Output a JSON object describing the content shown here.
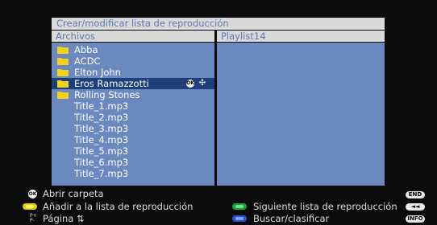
{
  "panel": {
    "title": "Crear/modificar lista de reproducción"
  },
  "left_column": {
    "header": "Archivos",
    "items": [
      {
        "type": "folder",
        "label": "Abba"
      },
      {
        "type": "folder",
        "label": "ACDC"
      },
      {
        "type": "folder",
        "label": "Elton John"
      },
      {
        "type": "folder",
        "label": "Eros Ramazzotti",
        "selected": true
      },
      {
        "type": "folder",
        "label": "Rolling Stones"
      },
      {
        "type": "file",
        "label": "Title_1.mp3"
      },
      {
        "type": "file",
        "label": "Title_2.mp3"
      },
      {
        "type": "file",
        "label": "Title_3.mp3"
      },
      {
        "type": "file",
        "label": "Title_4.mp3"
      },
      {
        "type": "file",
        "label": "Title_5.mp3"
      },
      {
        "type": "file",
        "label": "Title_6.mp3"
      },
      {
        "type": "file",
        "label": "Title_7.mp3"
      }
    ],
    "selected_ok_badge": "OK",
    "selected_move_icon": "move-arrows-icon"
  },
  "right_column": {
    "header": "Playlist14",
    "items": []
  },
  "footer": {
    "open_folder": {
      "icon": "ok-icon",
      "label": "Abrir carpeta"
    },
    "add_to_playlist": {
      "icon": "yellow-button-icon",
      "label": "Añadir a la lista de reproducción"
    },
    "page": {
      "icon": "page-updown-icon",
      "label": "Página ⇅"
    },
    "next_playlist": {
      "icon": "green-button-icon",
      "label": "Siguiente lista de reproducción"
    },
    "search_sort": {
      "icon": "blue-button-icon",
      "label": "Buscar/clasificar"
    },
    "end_badge": "END",
    "back_badge": "◄◄",
    "info_badge": "INFO"
  },
  "colors": {
    "background": "#0b0b0b",
    "pane_blue": "#6b89bf",
    "selected_blue": "#1f3f7a",
    "header_gray": "#d9d9d9",
    "folder_yellow": "#f3d21a"
  }
}
